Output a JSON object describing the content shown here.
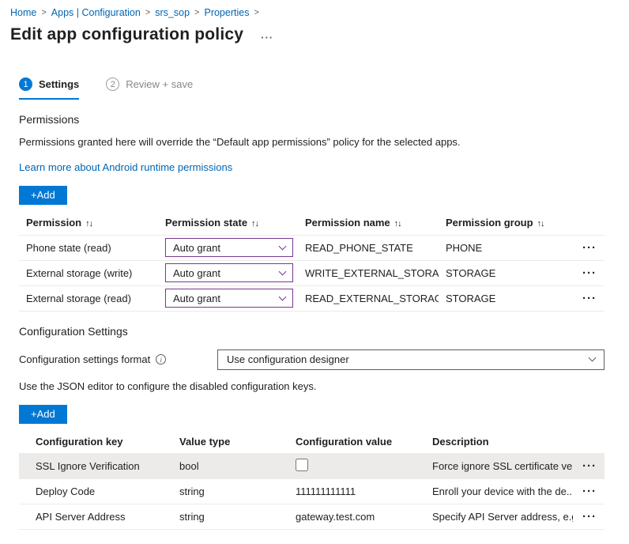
{
  "breadcrumb": {
    "separator": ">",
    "items": [
      {
        "label": "Home"
      },
      {
        "label": "Apps | Configuration"
      },
      {
        "label": "srs_sop"
      },
      {
        "label": "Properties"
      }
    ]
  },
  "header": {
    "title": "Edit app configuration policy",
    "more_menu": "···"
  },
  "steps": [
    {
      "number": "1",
      "label": "Settings"
    },
    {
      "number": "2",
      "label": "Review + save"
    }
  ],
  "permissions": {
    "section_title": "Permissions",
    "description": "Permissions granted here will override the “Default app permissions” policy for the selected apps.",
    "learn_more": "Learn more about Android runtime permissions",
    "add_button": "+Add",
    "table": {
      "sort_icon": "↑↓",
      "row_menu": "···",
      "headers": [
        "Permission",
        "Permission state",
        "Permission name",
        "Permission group"
      ],
      "rows": [
        {
          "permission": "Phone state (read)",
          "state": "Auto grant",
          "name": "READ_PHONE_STATE",
          "group": "PHONE"
        },
        {
          "permission": "External storage (write)",
          "state": "Auto grant",
          "name": "WRITE_EXTERNAL_STORAGE",
          "group": "STORAGE"
        },
        {
          "permission": "External storage (read)",
          "state": "Auto grant",
          "name": "READ_EXTERNAL_STORAGE",
          "group": "STORAGE"
        }
      ]
    }
  },
  "configuration": {
    "section_title": "Configuration Settings",
    "format_label": "Configuration settings format",
    "info_icon": "i",
    "format_value": "Use configuration designer",
    "json_note": "Use the JSON editor to configure the disabled configuration keys.",
    "add_button": "+Add",
    "table": {
      "row_menu": "···",
      "headers": [
        "Configuration key",
        "Value type",
        "Configuration value",
        "Description"
      ],
      "rows": [
        {
          "key": "SSL Ignore Verification",
          "type": "bool",
          "value": "",
          "description": "Force ignore SSL certificate ver..."
        },
        {
          "key": "Deploy Code",
          "type": "string",
          "value": "111111111111",
          "description": "Enroll your device with the de..."
        },
        {
          "key": "API Server Address",
          "type": "string",
          "value": "gateway.test.com",
          "description": "Specify API Server address, e.g..."
        }
      ]
    }
  }
}
